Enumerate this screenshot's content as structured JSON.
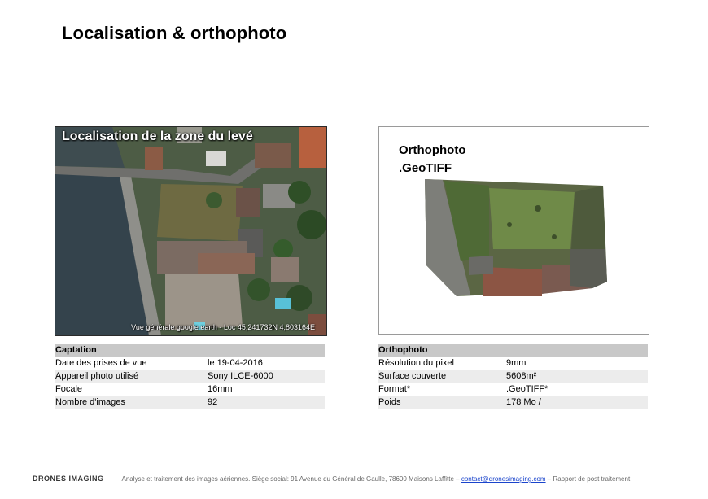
{
  "page": {
    "title": "Localisation & orthophoto"
  },
  "aerial": {
    "title": "Localisation de la zone du levé",
    "caption": "Vue générale google earth - Loc 45,241732N  4,803164E"
  },
  "ortho": {
    "title_line1": "Orthophoto",
    "title_line2": ".GeoTIFF"
  },
  "captation": {
    "header": "Captation",
    "rows": [
      {
        "label": "Date des prises de vue",
        "value": "le 19-04-2016"
      },
      {
        "label": "Appareil photo utilisé",
        "value": "Sony ILCE-6000"
      },
      {
        "label": "Focale",
        "value": "16mm"
      },
      {
        "label": "Nombre d'images",
        "value": "92"
      }
    ]
  },
  "orthophoto_table": {
    "header": "Orthophoto",
    "rows": [
      {
        "label": "Résolution du pixel",
        "value": "9mm"
      },
      {
        "label": "Surface couverte",
        "value": "5608m²"
      },
      {
        "label": "Format*",
        "value": ".GeoTIFF*"
      },
      {
        "label": "Poids",
        "value": "178 Mo /"
      }
    ]
  },
  "footer": {
    "logo": "DRONES IMAGING",
    "text_before": "Analyse et traitement des images aériennes. Siège social: 91 Avenue du Général de Gaulle, 78600 Maisons Laffitte – ",
    "email": "contact@dronesimaging.com",
    "text_after": " – Rapport de post traitement"
  }
}
